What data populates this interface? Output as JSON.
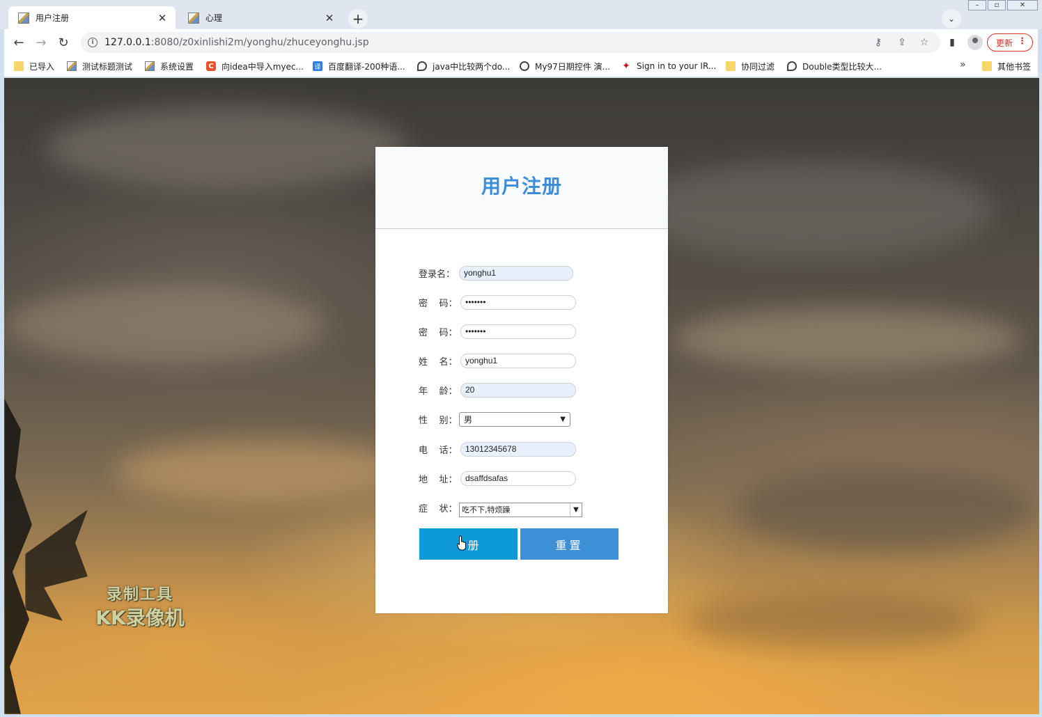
{
  "browser": {
    "tabs": [
      {
        "title": "用户注册",
        "active": true
      },
      {
        "title": "心理",
        "active": false
      }
    ],
    "address": {
      "host": "127.0.0.1",
      "rest": ":8080/z0xinlishi2m/yonghu/zhuceyonghu.jsp"
    },
    "update_label": "更新",
    "bookmarks": [
      {
        "label": "已导入",
        "icon": "folder-icon"
      },
      {
        "label": "测试标题测试",
        "icon": "image-icon"
      },
      {
        "label": "系统设置",
        "icon": "image-icon"
      },
      {
        "label": "向idea中导入myec...",
        "icon": "c-icon"
      },
      {
        "label": "百度翻译-200种语...",
        "icon": "translate-icon"
      },
      {
        "label": "java中比较两个do...",
        "icon": "swirl-icon"
      },
      {
        "label": "My97日期控件 演...",
        "icon": "globe-icon"
      },
      {
        "label": "Sign in to your IR...",
        "icon": "maple-leaf-icon"
      },
      {
        "label": "协同过滤",
        "icon": "folder-icon"
      },
      {
        "label": "Double类型比较大...",
        "icon": "swirl-icon"
      }
    ],
    "other_bookmarks": "其他书签",
    "more": "»"
  },
  "form": {
    "title": "用户注册",
    "fields": [
      {
        "label": "登录名：",
        "value": "yonghu1"
      },
      {
        "label": "密    码：",
        "value": "•••••••"
      },
      {
        "label": "密    码：",
        "value": "•••••••"
      },
      {
        "label": "姓    名：",
        "value": "yonghu1"
      },
      {
        "label": "年    龄：",
        "value": "20"
      },
      {
        "label": "性    别：",
        "value": "男"
      },
      {
        "label": "电    话：",
        "value": "13012345678"
      },
      {
        "label": "地    址：",
        "value": "dsaffdsafas"
      },
      {
        "label": "症    状：",
        "value": "吃不下,特烦躁"
      }
    ],
    "submit_label": "册",
    "reset_label": "重置"
  },
  "watermark": {
    "line1": "录制工具",
    "line2": "KK录像机"
  }
}
